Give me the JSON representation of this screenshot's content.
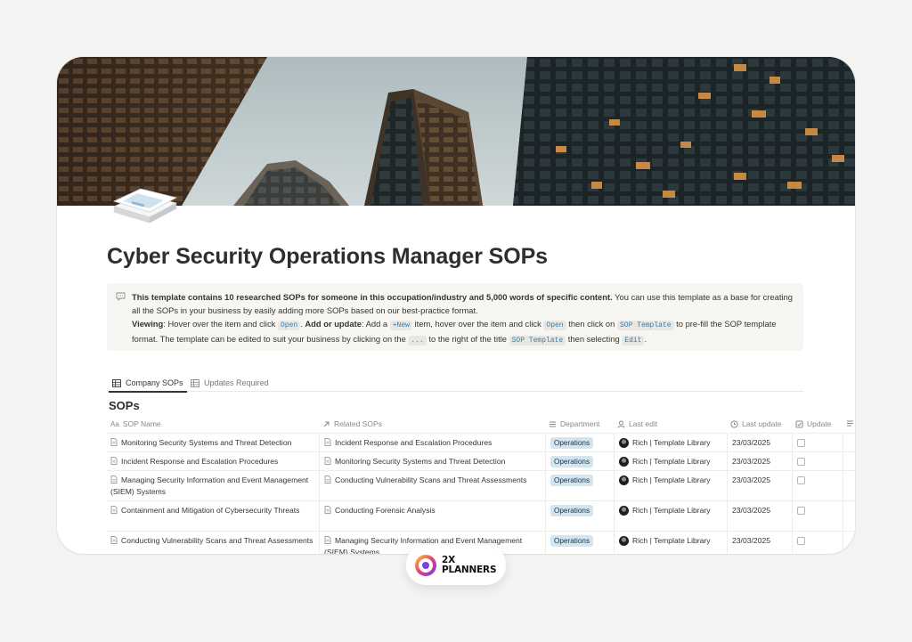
{
  "page": {
    "title": "Cyber Security Operations Manager SOPs",
    "icon": "document-stack-icon"
  },
  "callout": {
    "icon": "speech-bubble-icon",
    "line1_bold": "This template contains 10 researched SOPs for someone in this occupation/industry and 5,000 words of specific content.",
    "line1_rest": " You can use this template as a base for creating all the SOPs in your business by easily adding more SOPs based on our best-practice format.",
    "viewing_label": "Viewing",
    "viewing_text": ": Hover over the item and click ",
    "code_open": "Open",
    "add_label": "Add or update",
    "add_text": ": Add a ",
    "code_new": "+New",
    "add_text2": " item, hover over the item and click ",
    "add_text3": " then click on ",
    "code_sop_template": "SOP Template",
    "add_text4": " to pre-fill the SOP template format. The template can be edited to suit your business by clicking on the ",
    "code_dots": "...",
    "add_text5": " to the right of the title ",
    "add_text6": " then selecting ",
    "code_edit": "Edit",
    "period": "."
  },
  "tabs": [
    {
      "label": "Company SOPs",
      "active": true
    },
    {
      "label": "Updates Required",
      "active": false
    }
  ],
  "section_title": "SOPs",
  "table": {
    "columns": [
      "SOP Name",
      "Related SOPs",
      "Department",
      "Last edit",
      "Last update",
      "Update"
    ],
    "column_prefix": "Aa",
    "rows": [
      {
        "name": "Monitoring Security Systems and Threat Detection",
        "related": "Incident Response and Escalation Procedures",
        "department": "Operations",
        "editor": "Rich | Template Library",
        "date": "23/03/2025"
      },
      {
        "name": "Incident Response and Escalation Procedures",
        "related": "Monitoring Security Systems and Threat Detection",
        "department": "Operations",
        "editor": "Rich | Template Library",
        "date": "23/03/2025"
      },
      {
        "name": "Managing Security Information and Event Management (SIEM) Systems",
        "related": "Conducting Vulnerability Scans and Threat Assessments",
        "department": "Operations",
        "editor": "Rich | Template Library",
        "date": "23/03/2025"
      },
      {
        "name": "Containment and Mitigation of Cybersecurity Threats",
        "related": "Conducting Forensic Analysis",
        "department": "Operations",
        "editor": "Rich | Template Library",
        "date": "23/03/2025"
      },
      {
        "name": "Conducting Vulnerability Scans and Threat Assessments",
        "related": "Managing Security Information and Event Management (SIEM) Systems",
        "department": "Operations",
        "editor": "Rich | Template Library",
        "date": "23/03/2025"
      }
    ]
  },
  "brand": {
    "line1": "2X",
    "line2": "PLANNERS"
  },
  "colors": {
    "department_pill_bg": "#d3e5ef",
    "code_text": "#3d7ba8"
  }
}
